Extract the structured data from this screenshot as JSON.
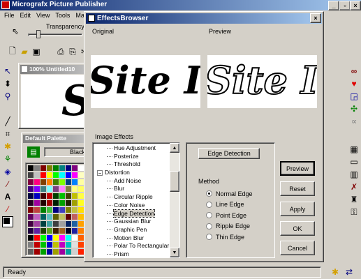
{
  "app": {
    "title": "Micrografx Picture Publisher",
    "status": "Ready"
  },
  "menu": [
    "File",
    "Edit",
    "View",
    "Tools",
    "Mask"
  ],
  "toolbar": {
    "transparency_label": "Transparency",
    "transparency_value": "0"
  },
  "image_window": {
    "title": "100% Untitled10"
  },
  "palette": {
    "title": "Default Palette",
    "selected_color": "Black"
  },
  "dialog": {
    "title": "EffectsBrowser",
    "original_label": "Original",
    "preview_label": "Preview",
    "sample_text": "Site In",
    "effects_label": "Image Effects",
    "effects": [
      {
        "label": "Hue Adjustment",
        "indent": 2,
        "selected": false
      },
      {
        "label": "Posterize",
        "indent": 2,
        "selected": false
      },
      {
        "label": "Threshold",
        "indent": 2,
        "selected": false
      },
      {
        "label": "Distortion",
        "indent": 1,
        "selected": false,
        "folder": "−"
      },
      {
        "label": "Add Noise",
        "indent": 2,
        "selected": false
      },
      {
        "label": "Blur",
        "indent": 2,
        "selected": false
      },
      {
        "label": "Circular Ripple",
        "indent": 2,
        "selected": false
      },
      {
        "label": "Color Noise",
        "indent": 2,
        "selected": false
      },
      {
        "label": "Edge Detection",
        "indent": 2,
        "selected": true
      },
      {
        "label": "Gaussian Blur",
        "indent": 2,
        "selected": false
      },
      {
        "label": "Graphic Pen",
        "indent": 2,
        "selected": false
      },
      {
        "label": "Motion Blur",
        "indent": 2,
        "selected": false
      },
      {
        "label": "Polar To Rectangular",
        "indent": 2,
        "selected": false
      },
      {
        "label": "Prism",
        "indent": 2,
        "selected": false
      }
    ],
    "effect_button": "Edge Detection",
    "method_label": "Method",
    "methods": [
      {
        "label": "Normal Edge",
        "checked": true
      },
      {
        "label": "Line Edge",
        "checked": false
      },
      {
        "label": "Point Edge",
        "checked": false
      },
      {
        "label": "Ripple Edge",
        "checked": false
      },
      {
        "label": "Thin Edge",
        "checked": false
      }
    ],
    "buttons": {
      "preview": "Preview",
      "reset": "Reset",
      "apply": "Apply",
      "ok": "OK",
      "cancel": "Cancel"
    }
  }
}
